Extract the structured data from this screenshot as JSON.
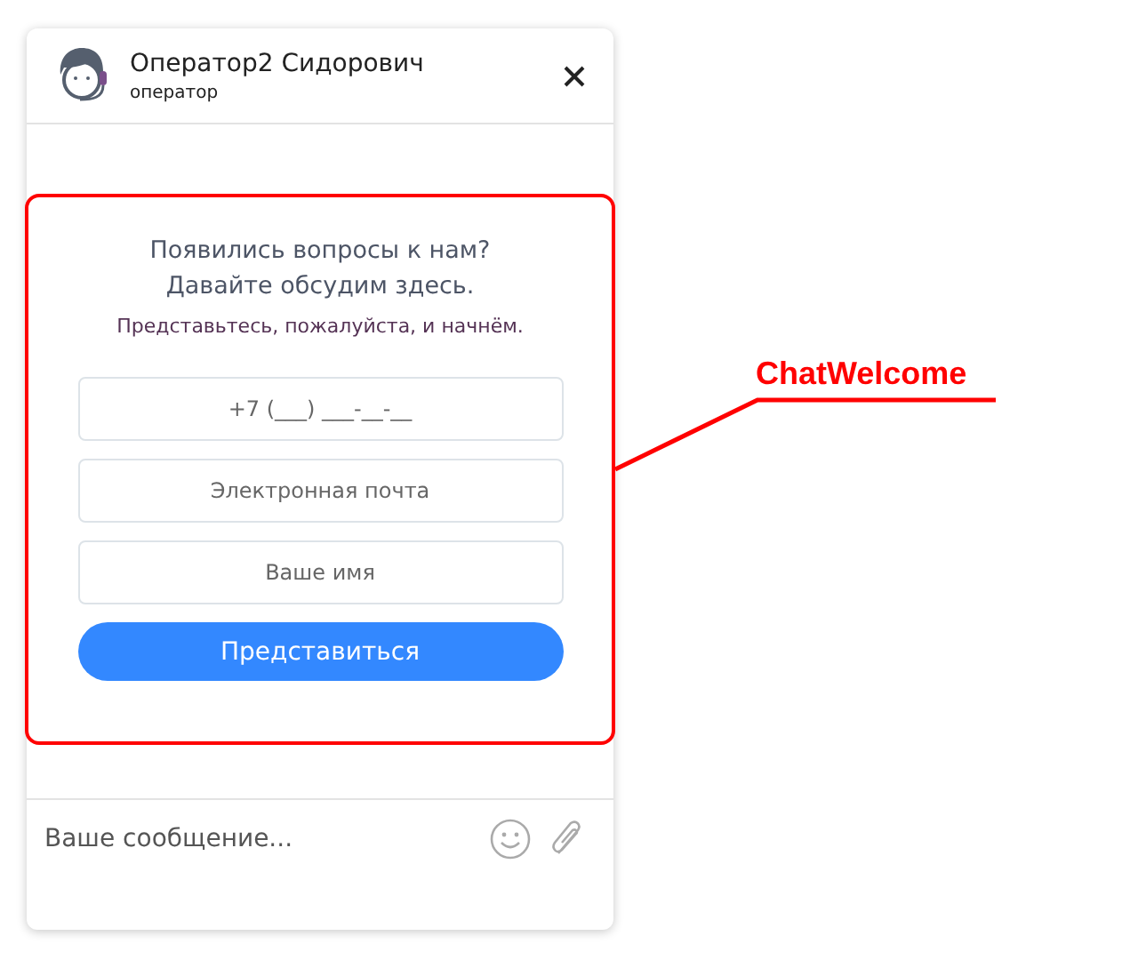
{
  "header": {
    "name": "Оператор2 Сидорович",
    "role": "оператор"
  },
  "welcome": {
    "title": "Появились вопросы к нам? Давайте обсудим здесь.",
    "subtitle": "Представьтесь, пожалуйста, и начнём.",
    "fields": [
      {
        "placeholder": "+7 (___) ___-__-__"
      },
      {
        "placeholder": "Электронная почта"
      },
      {
        "placeholder": "Ваше имя"
      }
    ],
    "submit": "Представиться"
  },
  "composer": {
    "placeholder": "Ваше сообщение..."
  },
  "annotation": {
    "label": "ChatWelcome"
  }
}
